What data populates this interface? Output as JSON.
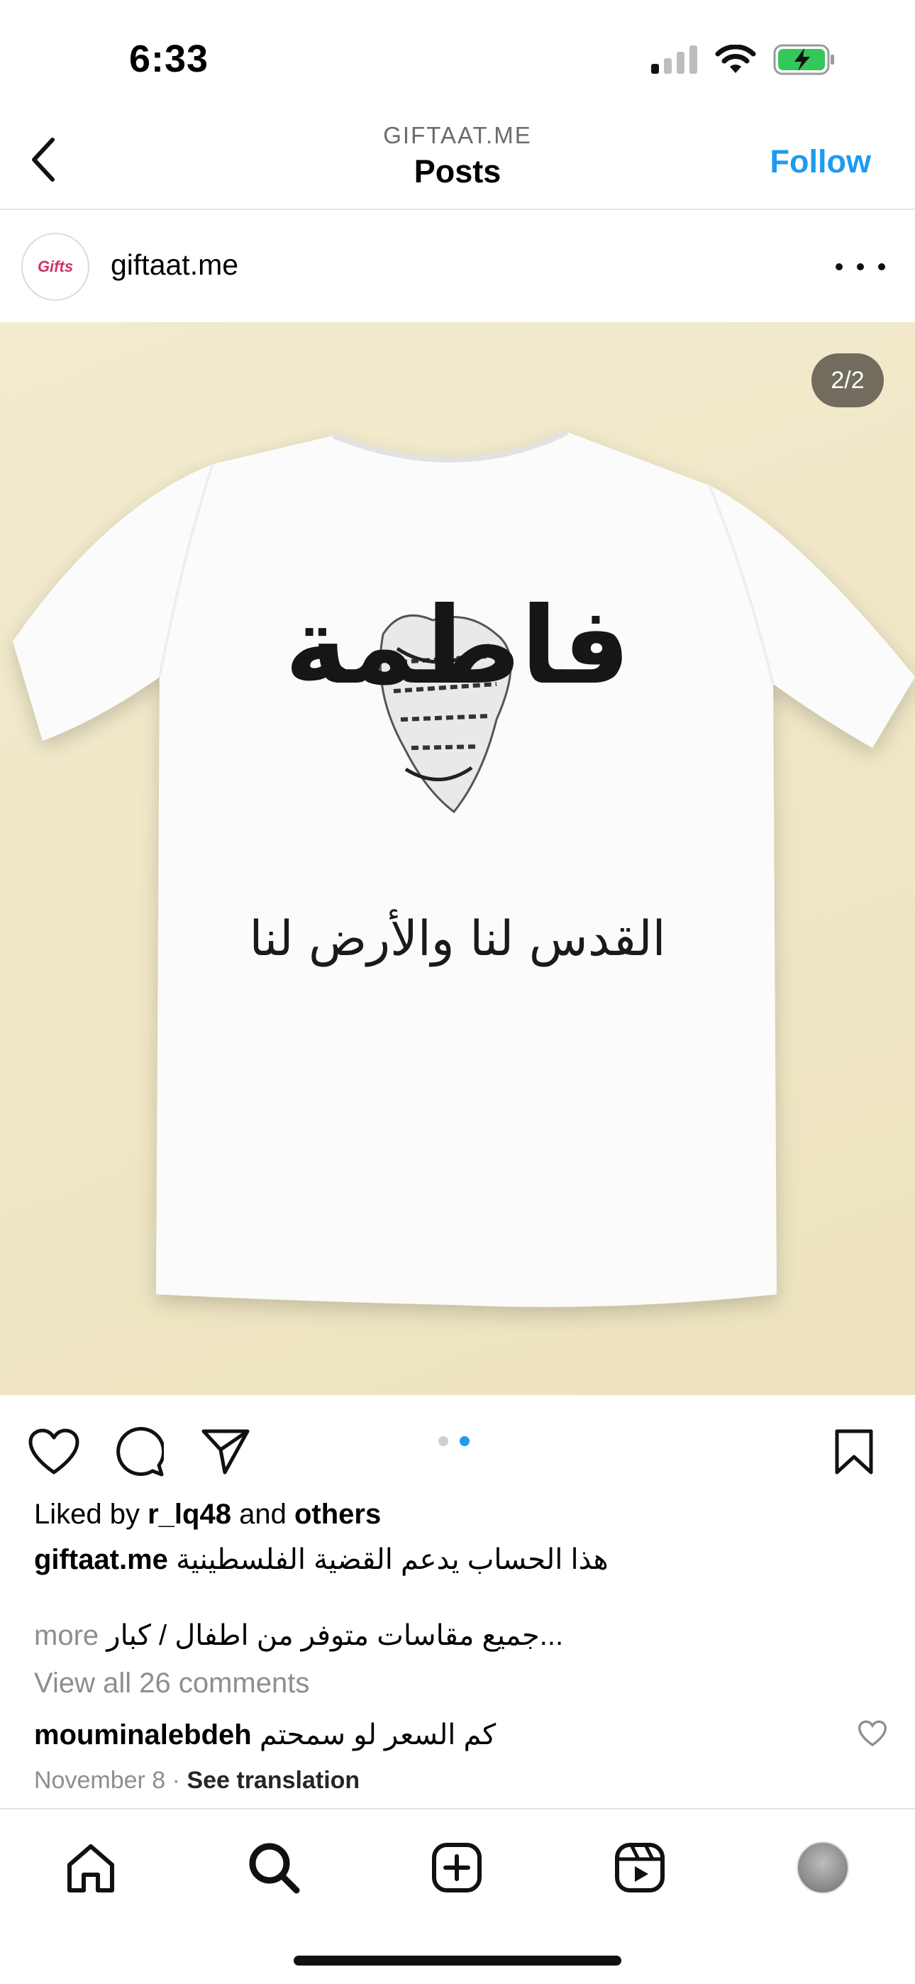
{
  "status": {
    "time": "6:33",
    "icons": [
      "cellular-signal-icon",
      "wifi-icon",
      "battery-charging-icon"
    ],
    "battery_color": "#34c759"
  },
  "nav": {
    "account": "GIFTAAT.ME",
    "title": "Posts",
    "follow": "Follow",
    "accent": "#1d9bf0"
  },
  "post": {
    "username": "giftaat.me",
    "avatar_text": "Gifts",
    "page_indicator": "2/2",
    "carousel": {
      "total": 2,
      "active": 2
    },
    "image": {
      "name_text": "فاطمة",
      "slogan_text": "القدس لنا والأرض لنا"
    },
    "liked_prefix": "Liked by",
    "liked_user": "r_lq48",
    "liked_and": "and",
    "liked_others": "others",
    "caption_user": "giftaat.me",
    "caption_text": "هذا الحساب يدعم القضية الفلسطينية",
    "caption_more_text": "جميع مقاسات متوفر من اطفال / كبار...",
    "caption_more_link": "more",
    "view_comments": "View all 26 comments",
    "comment_user": "mouminalebdeh",
    "comment_text": "كم السعر لو سمحتم",
    "date": "November 8",
    "separator": "·",
    "see_translation": "See translation"
  },
  "tabs": [
    "home-icon",
    "search-icon",
    "create-post-icon",
    "reels-icon",
    "profile-avatar"
  ]
}
